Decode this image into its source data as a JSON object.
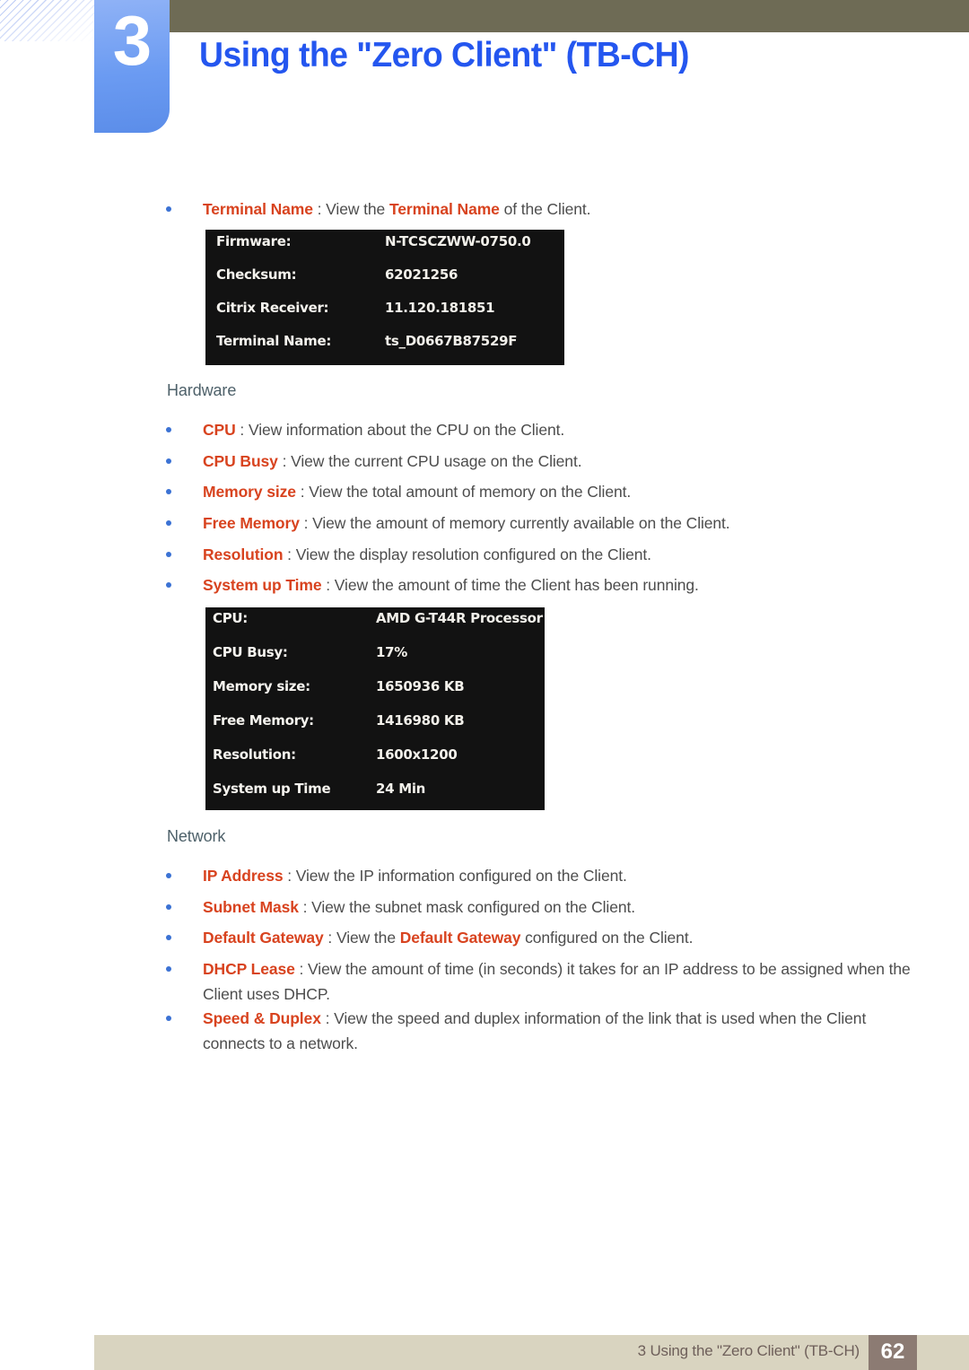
{
  "header": {
    "chapter_number": "3",
    "chapter_title": "Using the \"Zero Client\" (TB-CH)",
    "accent_blue": "#2456ef",
    "tab_blue": "#6b9bf2",
    "olive": "#6e6b55"
  },
  "body": {
    "intro_bullet": {
      "keyword": "Terminal Name",
      "separator": " : View the ",
      "keyword2": "Terminal Name",
      "tail": " of the Client."
    },
    "sections": [
      {
        "id": "hardware",
        "heading": "Hardware"
      },
      {
        "id": "network",
        "heading": "Network"
      }
    ],
    "hardware_bullets": [
      {
        "keyword": "CPU",
        "text": " : View information about the CPU on the Client."
      },
      {
        "keyword": "CPU Busy",
        "text": " : View the current CPU usage on the Client."
      },
      {
        "keyword": "Memory size",
        "text": " : View the total amount of memory on the Client."
      },
      {
        "keyword": "Free Memory",
        "text": " : View the amount of memory currently available on the Client."
      },
      {
        "keyword": "Resolution",
        "text": " : View the display resolution configured on the Client."
      },
      {
        "keyword": "System up Time",
        "text": " : View the amount of time the Client has been running."
      }
    ],
    "network_bullets": [
      {
        "keyword": "IP Address",
        "text": " : View the IP information configured on the Client."
      },
      {
        "keyword": "Subnet Mask",
        "text": " : View the subnet mask configured on the Client."
      },
      {
        "keyword": "Default Gateway",
        "text": " : View the ",
        "keyword2": "Default Gateway",
        "tail": " configured on the Client."
      },
      {
        "keyword": "DHCP Lease",
        "text": " : View the amount of time (in seconds) it takes for an IP address to be assigned when the Client uses DHCP."
      },
      {
        "keyword": "Speed & Duplex",
        "text": " : View the speed and duplex information of the link that is used when the Client connects to a network."
      }
    ]
  },
  "infobox_firmware": {
    "rows": [
      {
        "label": "Firmware:",
        "value": "N-TCSCZWW-0750.0"
      },
      {
        "label": "Checksum:",
        "value": "62021256"
      },
      {
        "label": "Citrix Receiver:",
        "value": "11.120.181851"
      },
      {
        "label": "Terminal Name:",
        "value": "ts_D0667B87529F"
      }
    ]
  },
  "infobox_hardware": {
    "rows": [
      {
        "label": "CPU:",
        "value": "AMD G-T44R Processor"
      },
      {
        "label": "CPU Busy:",
        "value": "17%"
      },
      {
        "label": "Memory size:",
        "value": "1650936 KB"
      },
      {
        "label": "Free Memory:",
        "value": "1416980 KB"
      },
      {
        "label": "Resolution:",
        "value": "1600x1200"
      },
      {
        "label": "System up Time",
        "value": "24 Min"
      }
    ]
  },
  "footer": {
    "text": "3 Using the \"Zero Client\" (TB-CH)",
    "page_number": "62",
    "bar_color": "#d9d4c0",
    "page_box_color": "#8c7b73"
  }
}
